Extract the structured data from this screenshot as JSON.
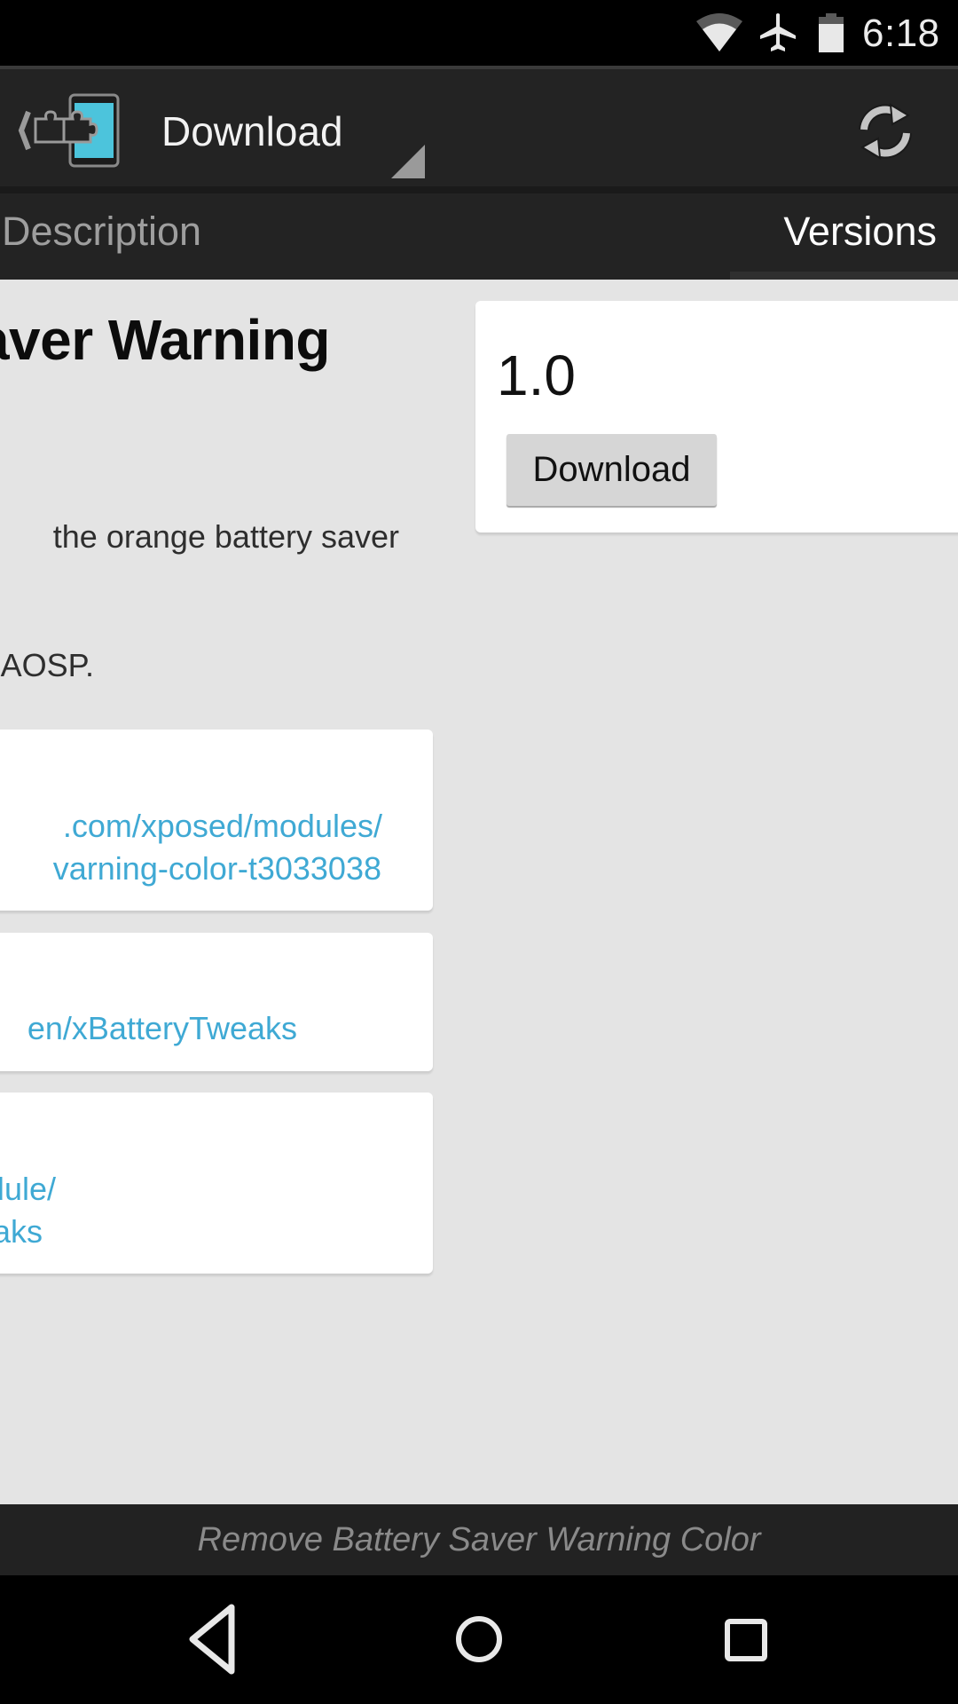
{
  "status_bar": {
    "time": "6:18",
    "icons": [
      "wifi-icon",
      "airplane-mode-icon",
      "battery-icon"
    ]
  },
  "action_bar": {
    "app_logo": "xposed-installer-logo",
    "spinner_label": "Download",
    "refresh_icon": "refresh-icon"
  },
  "tabs": [
    {
      "label": "Description",
      "selected": false
    },
    {
      "label": "Versions",
      "selected": true
    }
  ],
  "description_page": {
    "title_visible": "aver Warning",
    "lines": [
      "the orange battery saver",
      "AOSP."
    ],
    "links": [
      {
        "lines": [
          ".com/xposed/modules/",
          "varning-color-t3033038"
        ]
      },
      {
        "lines": [
          "en/xBatteryTweaks"
        ]
      },
      {
        "lines": [
          "dule/",
          "aks"
        ]
      }
    ]
  },
  "versions_page": {
    "versions": [
      {
        "name": "1.0",
        "download_label": "Download"
      }
    ]
  },
  "footer": {
    "module_name": "Remove Battery Saver Warning Color"
  },
  "nav_bar": {
    "buttons": [
      "back",
      "home",
      "recents"
    ]
  },
  "colors": {
    "accent_link": "#3fa9d4",
    "logo_cyan": "#4cc4dc",
    "action_bar_bg": "#232323",
    "content_bg": "#e4e4e4"
  }
}
